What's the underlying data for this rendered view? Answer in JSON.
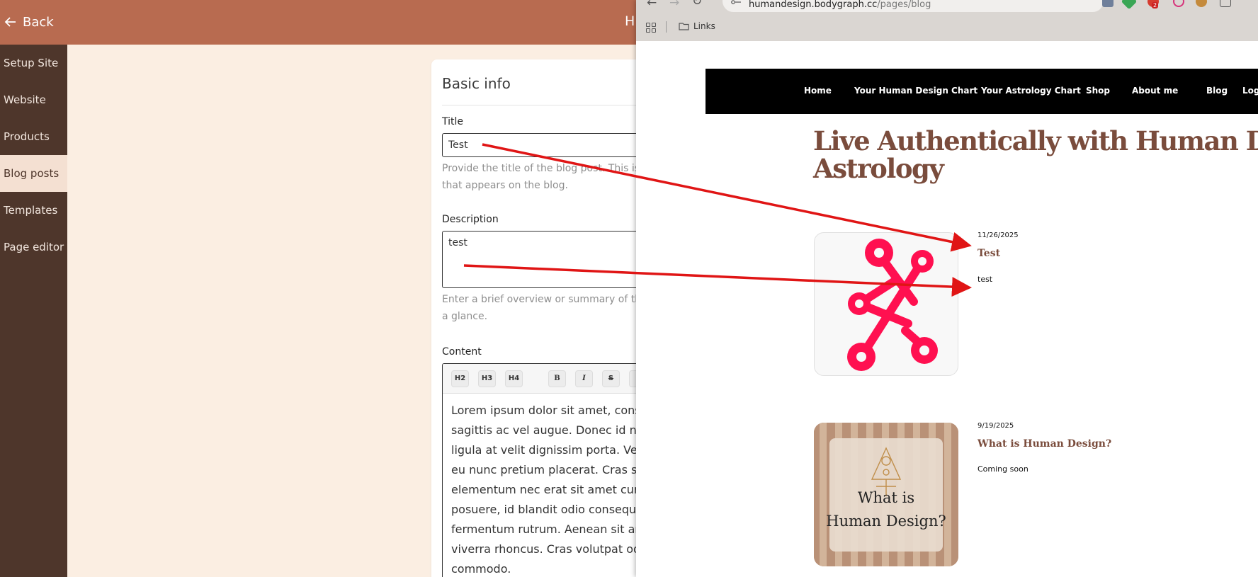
{
  "app": {
    "back_label": "Back",
    "brand": "HU",
    "sidebar": [
      {
        "label": "Setup Site",
        "active": false
      },
      {
        "label": "Website",
        "active": false
      },
      {
        "label": "Products",
        "active": false
      },
      {
        "label": "Blog posts",
        "active": true
      },
      {
        "label": "Templates",
        "active": false
      },
      {
        "label": "Page editor",
        "active": false
      }
    ],
    "form": {
      "section_title": "Basic info",
      "title_label": "Title",
      "title_value": "Test",
      "title_help_1": "Provide the title of the blog post. This is typ",
      "title_help_2": "that appears on the blog.",
      "description_label": "Description",
      "description_value": "test",
      "description_help_1": "Enter a brief overview or summary of the b",
      "description_help_2": "a glance.",
      "content_label": "Content",
      "toolbar": [
        "H2",
        "H3",
        "H4",
        "B",
        "I",
        "S"
      ],
      "content_lines": [
        "Lorem ipsum dolor sit amet, consec",
        "sagittis ac vel augue. Donec id nequ",
        "ligula at velit dignissim porta. Vestib",
        "eu nunc pretium placerat. Cras sed",
        "elementum nec erat sit amet cursu",
        "posuere, id blandit odio consequat.",
        "fermentum rutrum. Aenean sit ame",
        "viverra rhoncus. Cras volutpat odio",
        "commodo."
      ]
    }
  },
  "browser": {
    "url_host": "humandesign.bodygraph.cc",
    "url_path": "/pages/blog",
    "bookmark_folder": "Links",
    "extension_badge": "2",
    "site_nav": [
      "Home",
      "Your Human Design Chart",
      "Your Astrology Chart",
      "Shop",
      "About me",
      "Blog",
      "Log"
    ],
    "hero_line_1": "Live Authentically with Human Design &",
    "hero_line_2": "Astrology",
    "posts": [
      {
        "date": "11/26/2025",
        "title": "Test",
        "description": "test"
      },
      {
        "date": "9/19/2025",
        "title": "What is Human Design?",
        "description": "Coming soon",
        "image_text_1": "What is",
        "image_text_2": "Human Design?"
      }
    ]
  },
  "colors": {
    "topbar": "#b86b50",
    "sidebar": "#4e362b",
    "page_bg": "#fbeee2",
    "brand_text": "#7a4c3c",
    "logo_pink": "#ff1050",
    "annotation_arrow": "#e01515"
  }
}
